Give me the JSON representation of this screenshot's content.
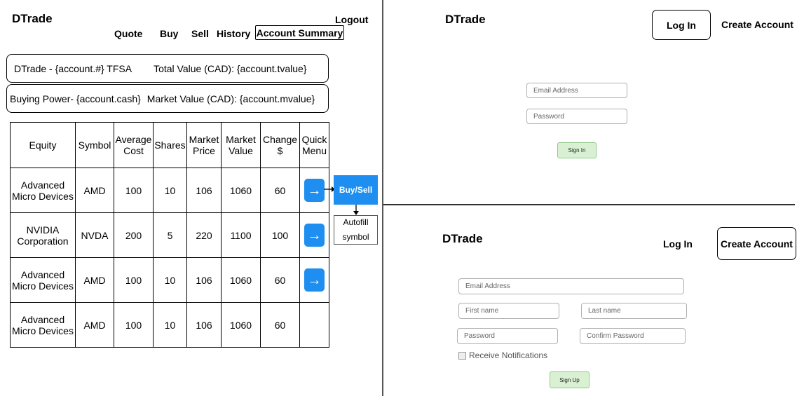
{
  "main": {
    "brand": "DTrade",
    "logout": "Logout",
    "nav": [
      "Quote",
      "Buy",
      "Sell",
      "History",
      "Account Summary"
    ],
    "account_line": "DTrade - {account.#} TFSA",
    "total_value": "Total Value (CAD): {account.tvalue}",
    "buying_power": "Buying Power- {account.cash}",
    "market_value": "Market Value (CAD): {account.mvalue}",
    "table": {
      "headers": {
        "equity": "Equity",
        "symbol": "Symbol",
        "avg_cost_1": "Average",
        "avg_cost_2": "Cost",
        "shares": "Shares",
        "mkt_price_1": "Market",
        "mkt_price_2": "Price",
        "mkt_value_1": "Market",
        "mkt_value_2": "Value",
        "change_1": "Change",
        "change_2": "$",
        "quick_1": "Quick",
        "quick_2": "Menu"
      },
      "rows": [
        {
          "equity_1": "Advanced",
          "equity_2": "Micro Devices",
          "symbol": "AMD",
          "avg_cost": "100",
          "shares": "10",
          "price": "106",
          "value": "1060",
          "change": "60",
          "quick": "→"
        },
        {
          "equity_1": "NVIDIA",
          "equity_2": "Corporation",
          "symbol": "NVDA",
          "avg_cost": "200",
          "shares": "5",
          "price": "220",
          "value": "1100",
          "change": "100",
          "quick": "→"
        },
        {
          "equity_1": "Advanced",
          "equity_2": "Micro Devices",
          "symbol": "AMD",
          "avg_cost": "100",
          "shares": "10",
          "price": "106",
          "value": "1060",
          "change": "60",
          "quick": "→"
        },
        {
          "equity_1": "Advanced",
          "equity_2": "Micro Devices",
          "symbol": "AMD",
          "avg_cost": "100",
          "shares": "10",
          "price": "106",
          "value": "1060",
          "change": "60"
        }
      ]
    },
    "buysell": "Buy/Sell",
    "autofill_1": "Autofill",
    "autofill_2": "symbol"
  },
  "login": {
    "brand": "DTrade",
    "login_button": "Log In",
    "create_link": "Create Account",
    "email_placeholder": "Email Address",
    "password_placeholder": "Password",
    "signin": "Sign In"
  },
  "signup": {
    "brand": "DTrade",
    "login_link": "Log In",
    "create_button": "Create Account",
    "email_placeholder": "Email Address",
    "first_name": "First name",
    "last_name": "Last name",
    "password": "Password",
    "confirm_password": "Confirm Password",
    "notifications": "Receive Notifications",
    "signup": "Sign Up"
  },
  "colors": {
    "accent": "#1e8ff0",
    "button_green": "#d9f0d3"
  }
}
